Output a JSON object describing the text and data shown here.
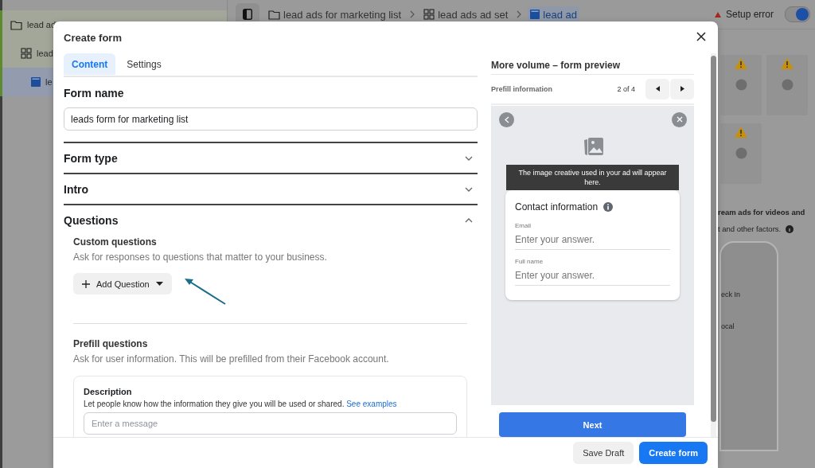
{
  "sidebar": {
    "items": [
      {
        "label": "lead ad",
        "kind": "folder",
        "selected": false,
        "children": [
          {
            "label": "lead",
            "kind": "adset",
            "selected": false,
            "children": [
              {
                "label": "le",
                "kind": "ad",
                "selected": true
              }
            ]
          }
        ]
      }
    ]
  },
  "breadcrumbs": [
    {
      "label": "lead ads for marketing list",
      "kind": "folder",
      "selected": false
    },
    {
      "label": "lead ads ad set",
      "kind": "adset",
      "selected": false
    },
    {
      "label": "lead ad",
      "kind": "ad",
      "selected": true
    }
  ],
  "status": {
    "label": "Setup error",
    "toggle_on": true
  },
  "background_panel": {
    "heading": "ream ads for videos and",
    "note": "t and other factors.",
    "phone_labels": [
      "eck In",
      "ocal"
    ]
  },
  "modal": {
    "title": "Create form",
    "tabs": [
      {
        "label": "Content",
        "selected": true
      },
      {
        "label": "Settings",
        "selected": false
      }
    ],
    "form_name": {
      "label": "Form name",
      "value": "leads form for marketing list"
    },
    "sections": [
      {
        "title": "Form type",
        "expanded": false
      },
      {
        "title": "Intro",
        "expanded": false
      },
      {
        "title": "Questions",
        "expanded": true
      }
    ],
    "custom_questions": {
      "title": "Custom questions",
      "description": "Ask for responses to questions that matter to your business.",
      "button": "Add Question"
    },
    "prefill": {
      "title": "Prefill questions",
      "description": "Ask for user information. This will be prefilled from their Facebook account.",
      "card": {
        "title": "Description",
        "text": "Let people know how the information they give you will be used or shared.",
        "link": "See examples",
        "placeholder": "Enter a message"
      }
    },
    "preview": {
      "title": "More volume – form preview",
      "page_label": "Prefill information",
      "counter": "2 of 4",
      "banner": "The image creative used in your ad will appear here.",
      "card_title": "Contact information",
      "fields": [
        {
          "label": "Email",
          "placeholder": "Enter your answer."
        },
        {
          "label": "Full name",
          "placeholder": "Enter your answer."
        }
      ],
      "next": "Next"
    },
    "footer": [
      {
        "label": "Save Draft",
        "kind": "secondary"
      },
      {
        "label": "Create form",
        "kind": "primary"
      }
    ]
  }
}
